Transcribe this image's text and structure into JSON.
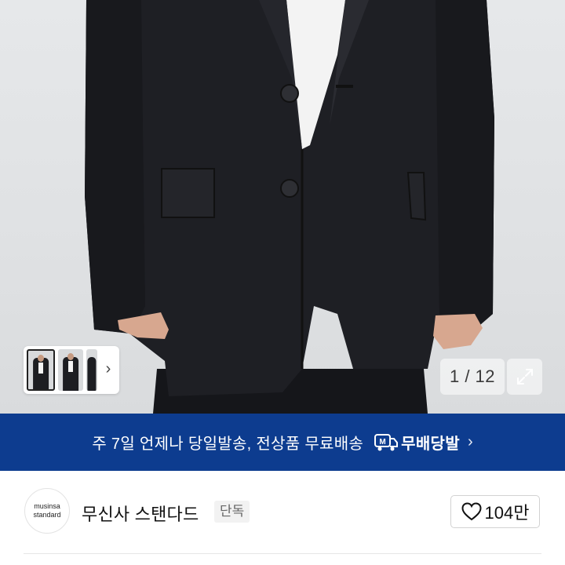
{
  "gallery": {
    "counter": "1 / 12"
  },
  "banner": {
    "text": "주 7일 언제나 당일발송, 전상품 무료배송",
    "badge": "무배당발",
    "badge_icon_letter": "M",
    "color": "#0d3c8f"
  },
  "brand": {
    "logo_line1": "musinsa",
    "logo_line2": "standard",
    "name": "무신사 스탠다드",
    "tag": "단독"
  },
  "like": {
    "count": "104만"
  },
  "icons": {
    "thumb_next": "chevron-right-icon",
    "expand": "expand-icon",
    "like": "heart-outline-icon",
    "banner": "delivery-truck-icon",
    "banner_next": "chevron-right-icon"
  }
}
